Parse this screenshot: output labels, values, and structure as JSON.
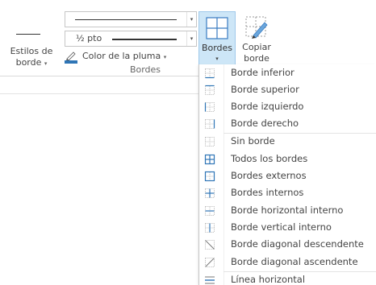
{
  "ribbon": {
    "border_styles": {
      "label_line1": "Estilos de",
      "label_line2": "borde",
      "caret": "▾"
    },
    "line_style": {
      "arrow": "▾"
    },
    "line_weight": {
      "value": "½ pto",
      "arrow": "▾"
    },
    "pen_color": {
      "label": "Color de la pluma",
      "caret": "▾",
      "color": "#2e75b6"
    },
    "borders_button": {
      "label": "Bordes",
      "caret": "▾"
    },
    "copy_border": {
      "label_line1": "Copiar",
      "label_line2": "borde"
    },
    "group_label": "Bordes"
  },
  "menu": {
    "items": [
      {
        "label": "Borde inferior",
        "icon": "border-bottom-icon"
      },
      {
        "label": "Borde superior",
        "icon": "border-top-icon"
      },
      {
        "label": "Borde izquierdo",
        "icon": "border-left-icon"
      },
      {
        "label": "Borde derecho",
        "icon": "border-right-icon"
      },
      {
        "label": "Sin borde",
        "icon": "no-border-icon"
      },
      {
        "label": "Todos los bordes",
        "icon": "all-borders-icon"
      },
      {
        "label": "Bordes externos",
        "icon": "outside-borders-icon"
      },
      {
        "label": "Bordes internos",
        "icon": "inside-borders-icon"
      },
      {
        "label": "Borde horizontal interno",
        "icon": "inside-horizontal-border-icon"
      },
      {
        "label": "Borde vertical interno",
        "icon": "inside-vertical-border-icon"
      },
      {
        "label": "Borde diagonal descendente",
        "icon": "diagonal-down-border-icon"
      },
      {
        "label": "Borde diagonal ascendente",
        "icon": "diagonal-up-border-icon"
      },
      {
        "label": "Línea horizontal",
        "icon": "horizontal-line-icon"
      }
    ]
  },
  "colors": {
    "accent": "#cde6f7",
    "accent_border": "#9fc9ea",
    "icon_blue": "#2e75b6"
  }
}
